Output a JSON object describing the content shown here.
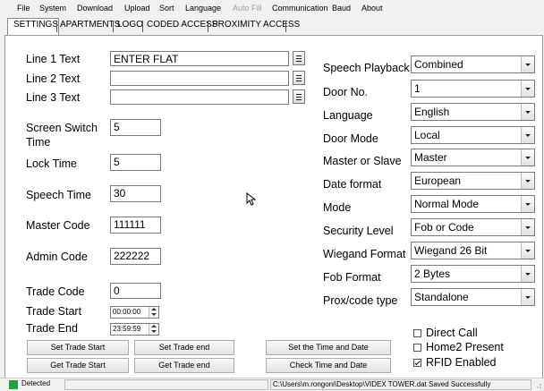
{
  "menu": [
    "File",
    "System",
    "Download",
    "Upload",
    "Sort",
    "Language",
    "Auto Fill",
    "Communication",
    "Baud",
    "About"
  ],
  "menu_disabled": "Auto Fill",
  "tabs": [
    "SETTINGS",
    "APARTMENTS",
    "LOGO",
    "CODED ACCESS",
    "PROXIMITY ACCESS"
  ],
  "active_tab": "SETTINGS",
  "left": {
    "line1_label": "Line 1 Text",
    "line1_value": "ENTER FLAT",
    "line2_label": "Line 2 Text",
    "line2_value": "",
    "line3_label": "Line 3 Text",
    "line3_value": "",
    "screen_switch_label": "Screen Switch Time",
    "screen_switch_value": "5",
    "lock_time_label": "Lock Time",
    "lock_time_value": "5",
    "speech_time_label": "Speech Time",
    "speech_time_value": "30",
    "master_code_label": "Master Code",
    "master_code_value": "111111",
    "admin_code_label": "Admin Code",
    "admin_code_value": "222222",
    "trade_code_label": "Trade Code",
    "trade_code_value": "0",
    "trade_start_label": "Trade Start",
    "trade_start_value": "00:00:00",
    "trade_end_label": "Trade End",
    "trade_end_value": "23:59:59"
  },
  "right": {
    "speech_playback_label": "Speech Playback",
    "speech_playback_value": "Combined",
    "door_no_label": "Door No.",
    "door_no_value": "1",
    "language_label": "Language",
    "language_value": "English",
    "door_mode_label": "Door Mode",
    "door_mode_value": "Local",
    "master_slave_label": "Master or Slave",
    "master_slave_value": "Master",
    "date_format_label": "Date format",
    "date_format_value": "European",
    "mode_label": "Mode",
    "mode_value": "Normal Mode",
    "security_level_label": "Security Level",
    "security_level_value": "Fob or Code",
    "wiegand_label": "Wiegand Format",
    "wiegand_value": "Wiegand 26 Bit",
    "fob_format_label": "Fob Format",
    "fob_format_value": "2 Bytes",
    "prox_type_label": "Prox/code type",
    "prox_type_value": "Standalone"
  },
  "buttons": {
    "set_trade_start": "Set Trade Start",
    "set_trade_end": "Set Trade end",
    "get_trade_start": "Get Trade Start",
    "get_trade_end": "Get Trade end",
    "set_time_date": "Set the Time and Date",
    "check_time_date": "Check Time and Date"
  },
  "checkboxes": [
    {
      "label": "Direct Call",
      "checked": false
    },
    {
      "label": "Home2 Present",
      "checked": false
    },
    {
      "label": "RFID Enabled",
      "checked": true
    }
  ],
  "status": {
    "connection": "Detected",
    "connection_color": "#22a045",
    "file_message": "C:\\Users\\m.rongoni\\Desktop\\VIDEX TOWER.dat  Saved Successfully"
  }
}
